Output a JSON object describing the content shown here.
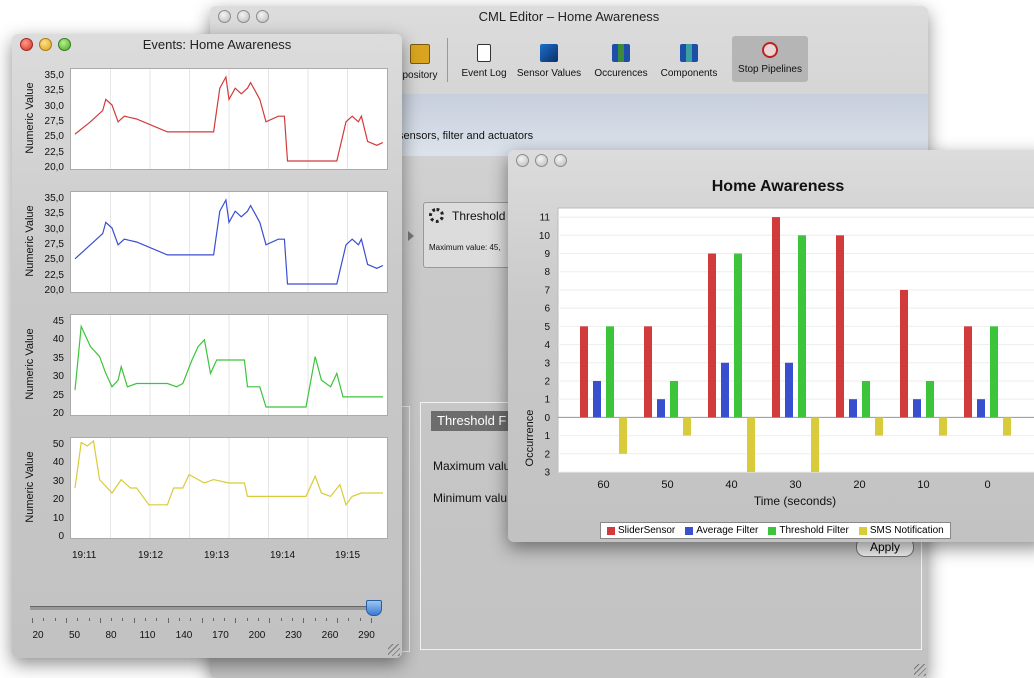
{
  "main_window": {
    "title": "CML Editor – Home Awareness",
    "toolbar": [
      {
        "label": "pository",
        "icon": "repository-icon"
      },
      {
        "label": "Event Log",
        "icon": "document-icon"
      },
      {
        "label": "Sensor Values",
        "icon": "sensor-values-icon"
      },
      {
        "label": "Occurences",
        "icon": "occurences-icon"
      },
      {
        "label": "Components",
        "icon": "components-icon"
      },
      {
        "label": "Stop Pipelines",
        "icon": "stop-pipelines-icon"
      }
    ],
    "banner_text": "sensors, filter and actuators",
    "threshold_node": {
      "label": "Threshold",
      "detail": "Maximum value: 45,"
    },
    "threshold_panel": {
      "header": "Threshold F",
      "max_label": "Maximum valu",
      "min_label": "Minimum valu",
      "apply_label": "Apply"
    }
  },
  "events_window": {
    "title": "Events: Home Awareness",
    "ylabel": "Numeric Value",
    "time_ticks": [
      "19:11",
      "19:12",
      "19:13",
      "19:14",
      "19:15"
    ],
    "plots": [
      {
        "color": "#d23b3b",
        "yticks": [
          "35,0",
          "32,5",
          "30,0",
          "27,5",
          "25,0",
          "22,5",
          "20,0"
        ],
        "points": [
          [
            0,
            24.8
          ],
          [
            0.05,
            27
          ],
          [
            0.09,
            29
          ],
          [
            0.1,
            31
          ],
          [
            0.12,
            30
          ],
          [
            0.14,
            27
          ],
          [
            0.16,
            28
          ],
          [
            0.2,
            27.5
          ],
          [
            0.3,
            25.2
          ],
          [
            0.45,
            25.2
          ],
          [
            0.47,
            33
          ],
          [
            0.49,
            35
          ],
          [
            0.5,
            31
          ],
          [
            0.52,
            33
          ],
          [
            0.54,
            32
          ],
          [
            0.56,
            33
          ],
          [
            0.57,
            34
          ],
          [
            0.6,
            31
          ],
          [
            0.62,
            27
          ],
          [
            0.66,
            28
          ],
          [
            0.68,
            28
          ],
          [
            0.69,
            20
          ],
          [
            0.85,
            20
          ],
          [
            0.88,
            27
          ],
          [
            0.9,
            28
          ],
          [
            0.92,
            27
          ],
          [
            0.93,
            28
          ],
          [
            0.95,
            23.5
          ],
          [
            0.98,
            22.8
          ],
          [
            1,
            23.3
          ]
        ]
      },
      {
        "color": "#3a4ed0",
        "yticks": [
          "35,0",
          "32,5",
          "30,0",
          "27,5",
          "25,0",
          "22,5",
          "20,0"
        ],
        "points": [
          [
            0,
            24.5
          ],
          [
            0.05,
            27
          ],
          [
            0.09,
            29
          ],
          [
            0.1,
            31
          ],
          [
            0.12,
            30
          ],
          [
            0.14,
            27
          ],
          [
            0.16,
            28
          ],
          [
            0.2,
            27.5
          ],
          [
            0.3,
            25.2
          ],
          [
            0.45,
            25.2
          ],
          [
            0.47,
            33
          ],
          [
            0.49,
            35
          ],
          [
            0.5,
            31
          ],
          [
            0.52,
            33
          ],
          [
            0.54,
            32
          ],
          [
            0.56,
            33
          ],
          [
            0.57,
            34
          ],
          [
            0.6,
            31
          ],
          [
            0.62,
            27
          ],
          [
            0.66,
            28
          ],
          [
            0.68,
            28
          ],
          [
            0.69,
            20
          ],
          [
            0.85,
            20
          ],
          [
            0.88,
            27
          ],
          [
            0.9,
            28
          ],
          [
            0.92,
            27
          ],
          [
            0.93,
            28
          ],
          [
            0.95,
            23.5
          ],
          [
            0.98,
            22.8
          ],
          [
            1,
            23.3
          ]
        ]
      },
      {
        "color": "#3cc43c",
        "yticks": [
          "45",
          "40",
          "35",
          "30",
          "25",
          "20"
        ],
        "points": [
          [
            0,
            25
          ],
          [
            0.02,
            44
          ],
          [
            0.05,
            38
          ],
          [
            0.08,
            35
          ],
          [
            0.1,
            30
          ],
          [
            0.12,
            26
          ],
          [
            0.14,
            28
          ],
          [
            0.15,
            32
          ],
          [
            0.17,
            26
          ],
          [
            0.2,
            27
          ],
          [
            0.3,
            27
          ],
          [
            0.33,
            26
          ],
          [
            0.35,
            27
          ],
          [
            0.38,
            34
          ],
          [
            0.4,
            38
          ],
          [
            0.42,
            40
          ],
          [
            0.44,
            30
          ],
          [
            0.46,
            34
          ],
          [
            0.5,
            34
          ],
          [
            0.55,
            34
          ],
          [
            0.56,
            26
          ],
          [
            0.6,
            26
          ],
          [
            0.62,
            20
          ],
          [
            0.75,
            20
          ],
          [
            0.78,
            35
          ],
          [
            0.8,
            28
          ],
          [
            0.83,
            26
          ],
          [
            0.85,
            30
          ],
          [
            0.87,
            23
          ],
          [
            1,
            23
          ]
        ]
      },
      {
        "color": "#d8cc3a",
        "yticks": [
          "50",
          "40",
          "30",
          "20",
          "10",
          "0"
        ],
        "points": [
          [
            0,
            25
          ],
          [
            0.02,
            52
          ],
          [
            0.04,
            50
          ],
          [
            0.06,
            53
          ],
          [
            0.08,
            30
          ],
          [
            0.1,
            26
          ],
          [
            0.12,
            22
          ],
          [
            0.15,
            30
          ],
          [
            0.18,
            25
          ],
          [
            0.2,
            25
          ],
          [
            0.24,
            15
          ],
          [
            0.3,
            15
          ],
          [
            0.32,
            25
          ],
          [
            0.35,
            25
          ],
          [
            0.37,
            33
          ],
          [
            0.4,
            30
          ],
          [
            0.42,
            28
          ],
          [
            0.45,
            30
          ],
          [
            0.5,
            28
          ],
          [
            0.55,
            28
          ],
          [
            0.56,
            20
          ],
          [
            0.6,
            20
          ],
          [
            0.75,
            20
          ],
          [
            0.78,
            32
          ],
          [
            0.8,
            22
          ],
          [
            0.83,
            20
          ],
          [
            0.86,
            27
          ],
          [
            0.88,
            15
          ],
          [
            0.9,
            20
          ],
          [
            0.93,
            22
          ],
          [
            1,
            22
          ]
        ]
      }
    ],
    "slider": {
      "ticks": [
        "20",
        "50",
        "80",
        "110",
        "140",
        "170",
        "200",
        "230",
        "260",
        "290"
      ],
      "value_fraction": 1.0
    }
  },
  "chart_window": {
    "chart_data": {
      "type": "bar",
      "title": "Home Awareness",
      "xlabel": "Time (seconds)",
      "ylabel": "Occurrence",
      "categories": [
        "60",
        "50",
        "40",
        "30",
        "20",
        "10",
        "0"
      ],
      "series": [
        {
          "name": "SliderSensor",
          "color": "#d23b3b",
          "values": [
            5,
            5,
            9,
            11,
            10,
            7,
            5
          ]
        },
        {
          "name": "Average Filter",
          "color": "#3a4ed0",
          "values": [
            2,
            1,
            3,
            3,
            1,
            1,
            1
          ]
        },
        {
          "name": "Threshold Filter",
          "color": "#3cc43c",
          "values": [
            5,
            2,
            9,
            10,
            2,
            2,
            5
          ]
        },
        {
          "name": "SMS Notification",
          "color": "#d8cc3a",
          "values": [
            -2,
            -1,
            -3,
            -3,
            -1,
            -1,
            -1
          ]
        }
      ],
      "yticks": [
        "11",
        "10",
        "9",
        "8",
        "7",
        "6",
        "5",
        "4",
        "3",
        "2",
        "1",
        "0",
        "1",
        "2",
        "3"
      ],
      "ylim": [
        -3,
        11.5
      ]
    }
  }
}
